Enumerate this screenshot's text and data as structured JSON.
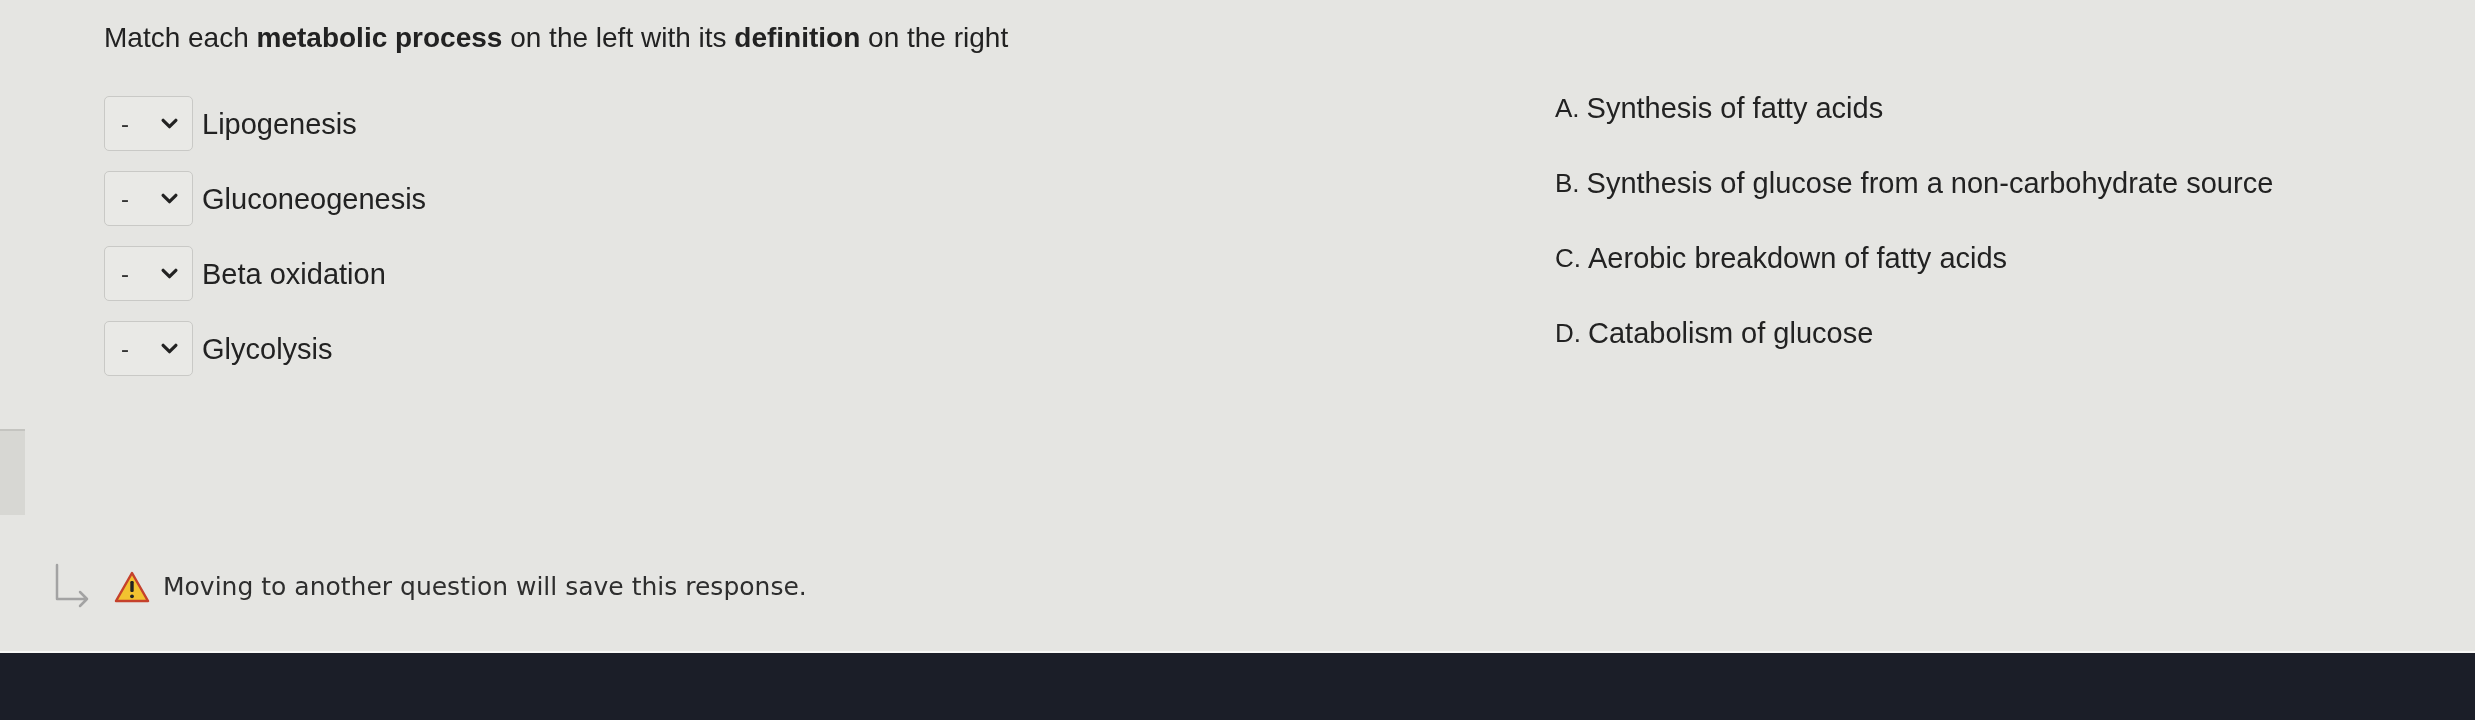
{
  "prompt": "Match each **metabolic process** on the left with its **definition** on the right",
  "matches": [
    {
      "value": "-",
      "term": "Lipogenesis"
    },
    {
      "value": "-",
      "term": "Gluconeogenesis"
    },
    {
      "value": "-",
      "term": "Beta oxidation"
    },
    {
      "value": "-",
      "term": "Glycolysis"
    }
  ],
  "definitions": [
    {
      "letter": "A.",
      "text": "Synthesis of fatty acids"
    },
    {
      "letter": "B.",
      "text": "Synthesis of glucose from a non-carbohydrate source"
    },
    {
      "letter": "C.",
      "text": "Aerobic breakdown of fatty acids"
    },
    {
      "letter": "D.",
      "text": "Catabolism of glucose"
    }
  ],
  "notice": {
    "text": "Moving to another question will save this response."
  }
}
